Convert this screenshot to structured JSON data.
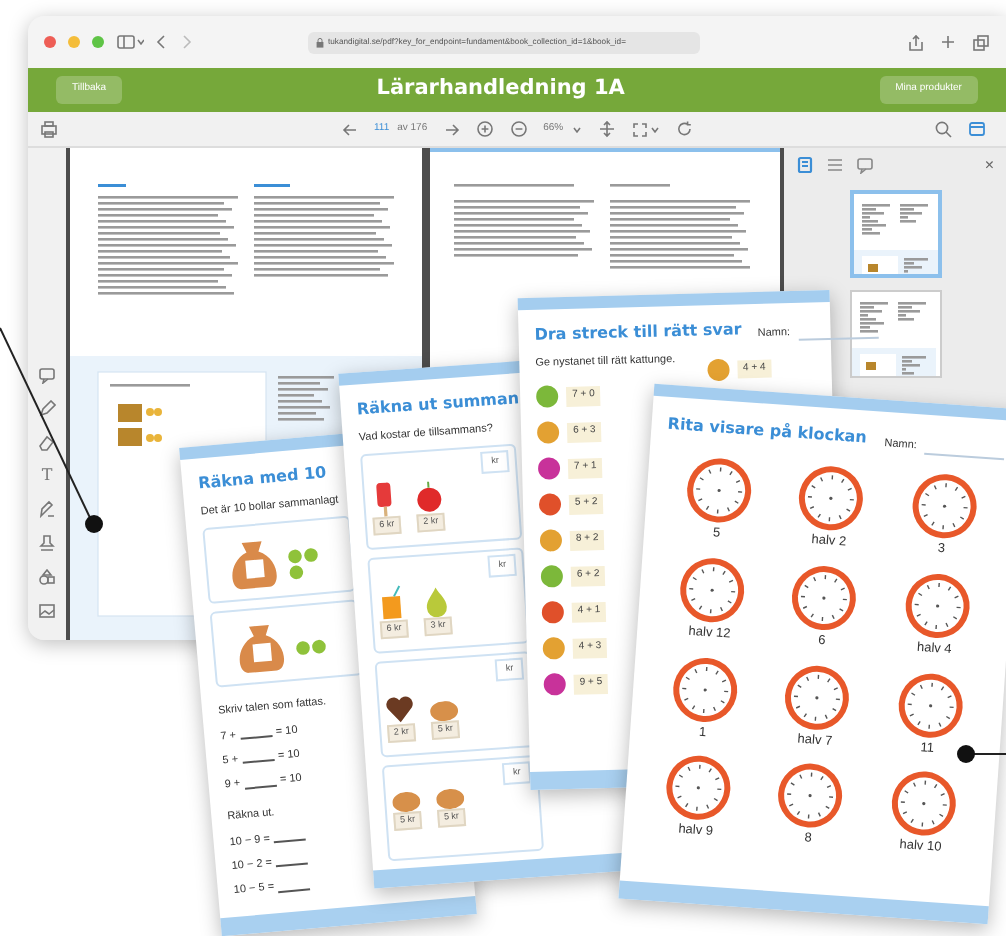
{
  "browser": {
    "url": "tukandigital.se/pdf?key_for_endpoint=fundament&book_collection_id=1&book_id=",
    "back_button": "Tillbaka",
    "title": "Lärarhandledning 1A",
    "products_button": "Mina produkter"
  },
  "pdf_toolbar": {
    "page": "111",
    "page_count": "av 176",
    "zoom": "66%"
  },
  "tool_rail": {
    "text_tool": "T"
  },
  "side_panel": {
    "tabs": [
      {
        "selected": true
      },
      {
        "selected": false
      },
      {
        "selected": false
      }
    ],
    "close": "×",
    "thumbnails": [
      {
        "selected": true
      },
      {
        "selected": false
      }
    ]
  },
  "sheet_count_to_10": {
    "title": "Räkna med 10",
    "prompt": "Det är 10 bollar sammanlagt",
    "fill_heading": "Skriv talen som fattas.",
    "fill_items": [
      {
        "left": "7 +",
        "right": "= 10"
      },
      {
        "left": "5 +",
        "right": "= 10"
      },
      {
        "left": "9 +",
        "right": "= 10"
      }
    ],
    "calc_heading": "Räkna ut.",
    "calc_items": [
      "10 − 9 =",
      "10 − 2 =",
      "10 − 5 ="
    ]
  },
  "sheet_sum": {
    "title": "Räkna ut summan",
    "prompt": "Vad kostar de tillsammans?",
    "rows": [
      {
        "prices": [
          "6 kr",
          "2 kr"
        ],
        "unit": "kr"
      },
      {
        "prices": [
          "6 kr",
          "3 kr"
        ],
        "unit": "kr"
      },
      {
        "prices": [
          "2 kr",
          "5 kr"
        ],
        "unit": "kr"
      },
      {
        "prices": [
          "5 kr",
          "5 kr"
        ],
        "unit": "kr"
      }
    ]
  },
  "sheet_match": {
    "title": "Dra streck till rätt svar",
    "name_label": "Namn:",
    "prompt": "Ge nystanet till rätt kattunge.",
    "yarns": [
      {
        "expr": "7 + 0",
        "color": "#7cb83a"
      },
      {
        "expr": "6 + 3",
        "color": "#e3a132"
      },
      {
        "expr": "7 + 1",
        "color": "#c8329a"
      },
      {
        "expr": "5 + 2",
        "color": "#e0502a"
      },
      {
        "expr": "8 + 2",
        "color": "#e3a132"
      },
      {
        "expr": "6 + 2",
        "color": "#7cb83a"
      },
      {
        "expr": "4 + 1",
        "color": "#e0502a"
      },
      {
        "expr": "4 + 3",
        "color": "#e3a132"
      },
      {
        "expr": "9 + 5",
        "color": "#c8329a"
      }
    ],
    "kittens": [
      {
        "expr": "4 + 4",
        "color": "#e3a132"
      }
    ]
  },
  "sheet_clock": {
    "title": "Rita visare på klockan",
    "name_label": "Namn:",
    "clocks": [
      "5",
      "halv 2",
      "3",
      "halv 12",
      "6",
      "halv 4",
      "1",
      "halv 7",
      "11",
      "halv 9",
      "8",
      "halv 10"
    ]
  }
}
